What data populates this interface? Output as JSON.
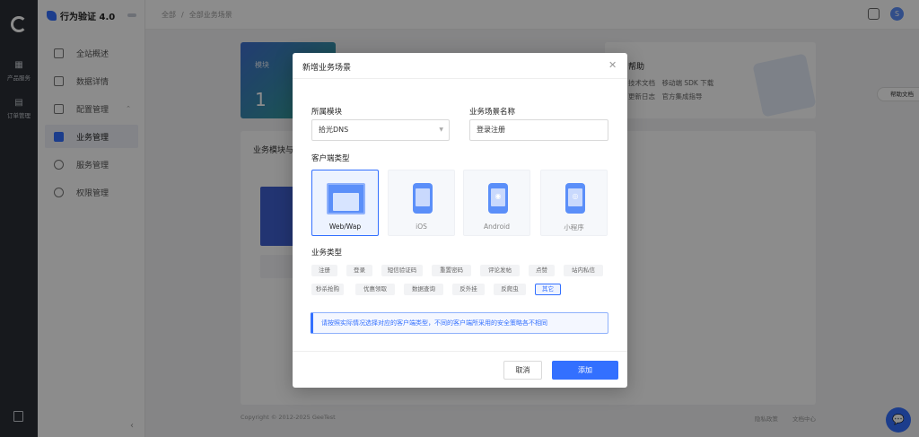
{
  "app": {
    "brand": "行为验证 4.0",
    "brand_badge": "",
    "rail_items": [
      {
        "label": "产品服务",
        "icon": "grid-icon"
      },
      {
        "label": "订单管理",
        "icon": "document-icon"
      }
    ]
  },
  "sidebar": {
    "items": [
      {
        "label": "全站概述",
        "icon": "file-icon",
        "active": false
      },
      {
        "label": "数据详情",
        "icon": "chart-icon",
        "active": false
      },
      {
        "label": "配置管理",
        "icon": "warning-icon",
        "active": false,
        "expandable": true
      },
      {
        "label": "业务管理",
        "icon": "calendar-icon",
        "active": true
      },
      {
        "label": "服务管理",
        "icon": "service-icon",
        "active": false
      },
      {
        "label": "权限管理",
        "icon": "dollar-icon",
        "active": false
      }
    ]
  },
  "header": {
    "breadcrumb": [
      "全部",
      "全部业务场景"
    ],
    "avatar_initial": "S"
  },
  "background": {
    "module_card_label": "模块",
    "module_card_value": "1",
    "help_title": "帮助",
    "help_line1": "技术文档　移动端 SDK 下载",
    "help_line2": "更新日志　官方集成指导",
    "panel_title": "业务模块与...",
    "footer_copyright": "Copyright © 2012-2025 GeeTest",
    "footer_links": [
      "隐私政策",
      "文档中心"
    ],
    "help_float": "帮助文档"
  },
  "modal": {
    "title": "新增业务场景",
    "module_label": "所属模块",
    "module_value": "拾光DNS",
    "scene_label": "业务场景名称",
    "scene_value": "登录注册",
    "client_label": "客户端类型",
    "client_types": [
      {
        "label": "Web/Wap",
        "selected": true
      },
      {
        "label": "iOS",
        "selected": false
      },
      {
        "label": "Android",
        "selected": false
      },
      {
        "label": "小程序",
        "selected": false
      }
    ],
    "biz_label": "业务类型",
    "biz_types": [
      [
        "注册",
        "登录",
        "短信验证码",
        "重置密码",
        "评论发帖",
        "点赞",
        "站内私信"
      ],
      [
        "秒杀抢购",
        "优惠领取",
        "数据查询",
        "反外挂",
        "反爬虫",
        "其它"
      ]
    ],
    "biz_selected": "其它",
    "notice": "请按照实际情况选择对应的客户端类型，不同的客户端所采用的安全策略各不相同",
    "cancel_label": "取消",
    "confirm_label": "添加"
  },
  "colors": {
    "primary": "#3370ff",
    "rail": "#2b2f36"
  }
}
